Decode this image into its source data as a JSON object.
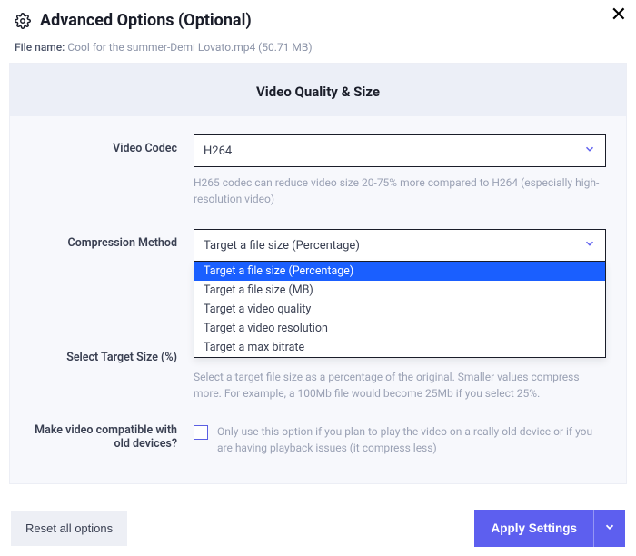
{
  "header": {
    "title": "Advanced Options (Optional)"
  },
  "file": {
    "label": "File name:",
    "value": "Cool for the summer-Demi Lovato.mp4 (50.71 MB)"
  },
  "panel": {
    "title": "Video Quality & Size",
    "codec": {
      "label": "Video Codec",
      "value": "H264",
      "helper": "H265 codec can reduce video size 20-75% more compared to H264 (especially high-resolution video)"
    },
    "compression": {
      "label": "Compression Method",
      "value": "Target a file size (Percentage)",
      "options": [
        "Target a file size (Percentage)",
        "Target a file size (MB)",
        "Target a video quality",
        "Target a video resolution",
        "Target a max bitrate"
      ]
    },
    "target": {
      "label": "Select Target Size (%)",
      "helper": "Select a target file size as a percentage of the original. Smaller values compress more. For example, a 100Mb file would become 25Mb if you select 25%."
    },
    "compat": {
      "label": "Make video compatible with old devices?",
      "helper": "Only use this option if you plan to play the video on a really old device or if you are having playback issues (it compress less)"
    }
  },
  "footer": {
    "reset": "Reset all options",
    "apply": "Apply Settings"
  }
}
